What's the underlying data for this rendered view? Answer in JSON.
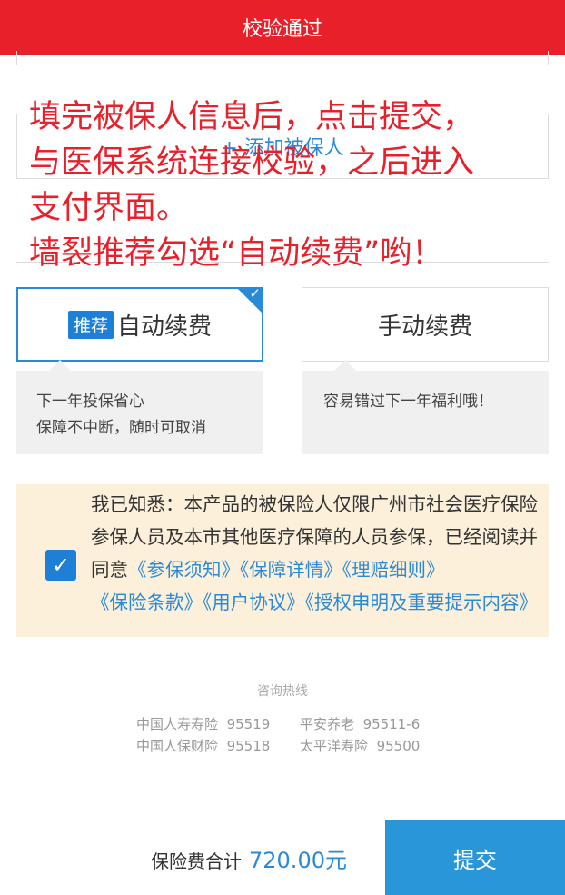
{
  "banner": {
    "text": "校验通过"
  },
  "add_insured": {
    "label": "+ 添加被保人"
  },
  "overlay": {
    "lines": [
      "填完被保人信息后，点击提交，",
      "与医保系统连接校验，之后进入",
      "支付界面。",
      "墙裂推荐勾选“自动续费”哟！"
    ]
  },
  "renew_options": {
    "auto": {
      "tag": "推荐",
      "label": "自动续费",
      "tip_line1": "下一年投保省心",
      "tip_line2": "保障不中断，随时可取消",
      "check": "✓"
    },
    "manual": {
      "label": "手动续费",
      "tip": "容易错过下一年福利哦！"
    }
  },
  "agreement": {
    "check": "✓",
    "text": "我已知悉：本产品的被保险人仅限广州市社会医疗保险参保人员及本市其他医疗保障的人员参保，已经阅读并同意",
    "links": [
      "《参保须知》",
      "《保障详情》",
      "《理赔细则》",
      "《保险条款》",
      "《用户协议》",
      "《授权申明及重要提示内容》"
    ]
  },
  "hotline": {
    "title": "咨询热线",
    "entries": [
      {
        "name": "中国人寿寿险",
        "phone": "95519"
      },
      {
        "name": "平安养老",
        "phone": "95511-6"
      },
      {
        "name": "中国人保财险",
        "phone": "95518"
      },
      {
        "name": "太平洋寿险",
        "phone": "95500"
      }
    ]
  },
  "footer": {
    "total_label": "保险费合计",
    "total_amount": "720.00元",
    "submit_label": "提交"
  },
  "colors": {
    "brand_red": "#e8202a",
    "accent_blue": "#2a8ad8",
    "notice_bg": "#fdf0da"
  }
}
